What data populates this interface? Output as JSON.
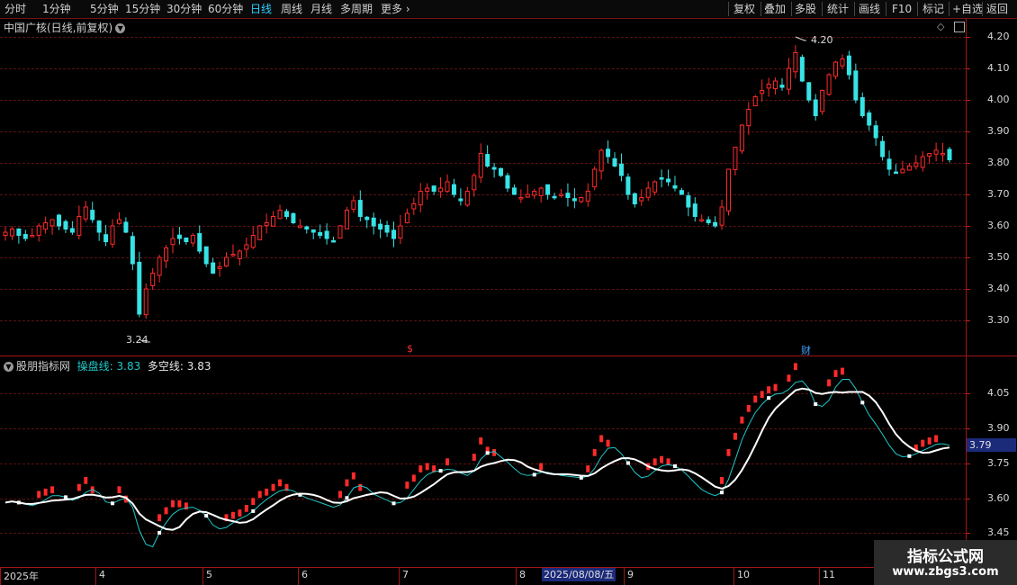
{
  "toolbar": {
    "left_items": [
      "分时",
      "1分钟",
      "5分钟",
      "15分钟",
      "30分钟",
      "60分钟",
      "日线",
      "周线",
      "月线",
      "多周期",
      "更多"
    ],
    "active": "日线",
    "right_items": [
      "复权",
      "叠加",
      "多股",
      "统计",
      "画线",
      "F10",
      "标记",
      "+自选",
      "返回"
    ]
  },
  "main_chart": {
    "title": "中国广核(日线,前复权)",
    "high_label": "4.20",
    "low_label": "3.24",
    "y_ticks": [
      "4.20",
      "4.10",
      "4.00",
      "3.90",
      "3.80",
      "3.70",
      "3.60",
      "3.50",
      "3.40",
      "3.30"
    ],
    "event_markers": [
      "$",
      "财"
    ]
  },
  "indicator": {
    "name": "股朋指标网",
    "line1_label": "操盘线:",
    "line1_value": "3.83",
    "line2_label": "多空线:",
    "line2_value": "3.83",
    "y_ticks": [
      "4.05",
      "3.90",
      "3.75",
      "3.60",
      "3.45"
    ],
    "current_value": "3.79"
  },
  "x_axis": {
    "labels": [
      "2025年",
      "4",
      "5",
      "6",
      "7",
      "8",
      "9",
      "10",
      "11"
    ],
    "cursor_date": "2025/08/08/五"
  },
  "watermark": {
    "line1": "指标公式网",
    "line2": "www.zbgs3.com"
  },
  "colors": {
    "up": "#ff2a2a",
    "down": "#37e3e6",
    "line1": "#1fc8c8",
    "line2": "#ffffff",
    "grid": "#5a1212",
    "active_tab": "#2fd0ff"
  },
  "chart_data": {
    "type": "candlestick",
    "title": "中国广核(日线,前复权)",
    "ylim": [
      3.2,
      4.25
    ],
    "y_ticks": [
      4.2,
      4.1,
      4.0,
      3.9,
      3.8,
      3.7,
      3.6,
      3.5,
      3.4,
      3.3
    ],
    "x_months": [
      "2025年",
      "4",
      "5",
      "6",
      "7",
      "8",
      "9",
      "10",
      "11"
    ],
    "highest": 4.2,
    "lowest": 3.24,
    "series_close": [
      3.58,
      3.59,
      3.57,
      3.56,
      3.57,
      3.6,
      3.61,
      3.62,
      3.6,
      3.59,
      3.58,
      3.63,
      3.66,
      3.62,
      3.58,
      3.55,
      3.6,
      3.62,
      3.58,
      3.48,
      3.32,
      3.4,
      3.45,
      3.5,
      3.53,
      3.56,
      3.56,
      3.55,
      3.57,
      3.52,
      3.48,
      3.45,
      3.47,
      3.5,
      3.51,
      3.52,
      3.54,
      3.57,
      3.6,
      3.61,
      3.63,
      3.65,
      3.63,
      3.61,
      3.6,
      3.59,
      3.58,
      3.57,
      3.56,
      3.55,
      3.6,
      3.65,
      3.68,
      3.63,
      3.62,
      3.6,
      3.59,
      3.58,
      3.56,
      3.6,
      3.64,
      3.67,
      3.71,
      3.72,
      3.71,
      3.72,
      3.74,
      3.7,
      3.68,
      3.71,
      3.76,
      3.83,
      3.79,
      3.78,
      3.76,
      3.72,
      3.7,
      3.69,
      3.7,
      3.71,
      3.72,
      3.7,
      3.69,
      3.7,
      3.69,
      3.68,
      3.69,
      3.71,
      3.78,
      3.84,
      3.82,
      3.79,
      3.76,
      3.7,
      3.67,
      3.69,
      3.72,
      3.74,
      3.75,
      3.74,
      3.72,
      3.7,
      3.66,
      3.63,
      3.62,
      3.61,
      3.6,
      3.66,
      3.78,
      3.85,
      3.92,
      3.97,
      4.01,
      4.03,
      4.05,
      4.06,
      4.04,
      4.1,
      4.15,
      4.06,
      4.0,
      3.95,
      4.03,
      4.08,
      4.12,
      4.13,
      4.08,
      4.0,
      3.95,
      3.92,
      3.88,
      3.82,
      3.78,
      3.77,
      3.78,
      3.79,
      3.8,
      3.82,
      3.83,
      3.84,
      3.83,
      3.81
    ],
    "indicator": {
      "name": "股朋指标网",
      "series": [
        {
          "name": "操盘线",
          "value": 3.83
        },
        {
          "name": "多空线",
          "value": 3.83
        }
      ],
      "ylim": [
        3.4,
        4.15
      ],
      "y_ticks": [
        4.05,
        3.9,
        3.75,
        3.6,
        3.45
      ],
      "current_value": 3.79
    }
  }
}
